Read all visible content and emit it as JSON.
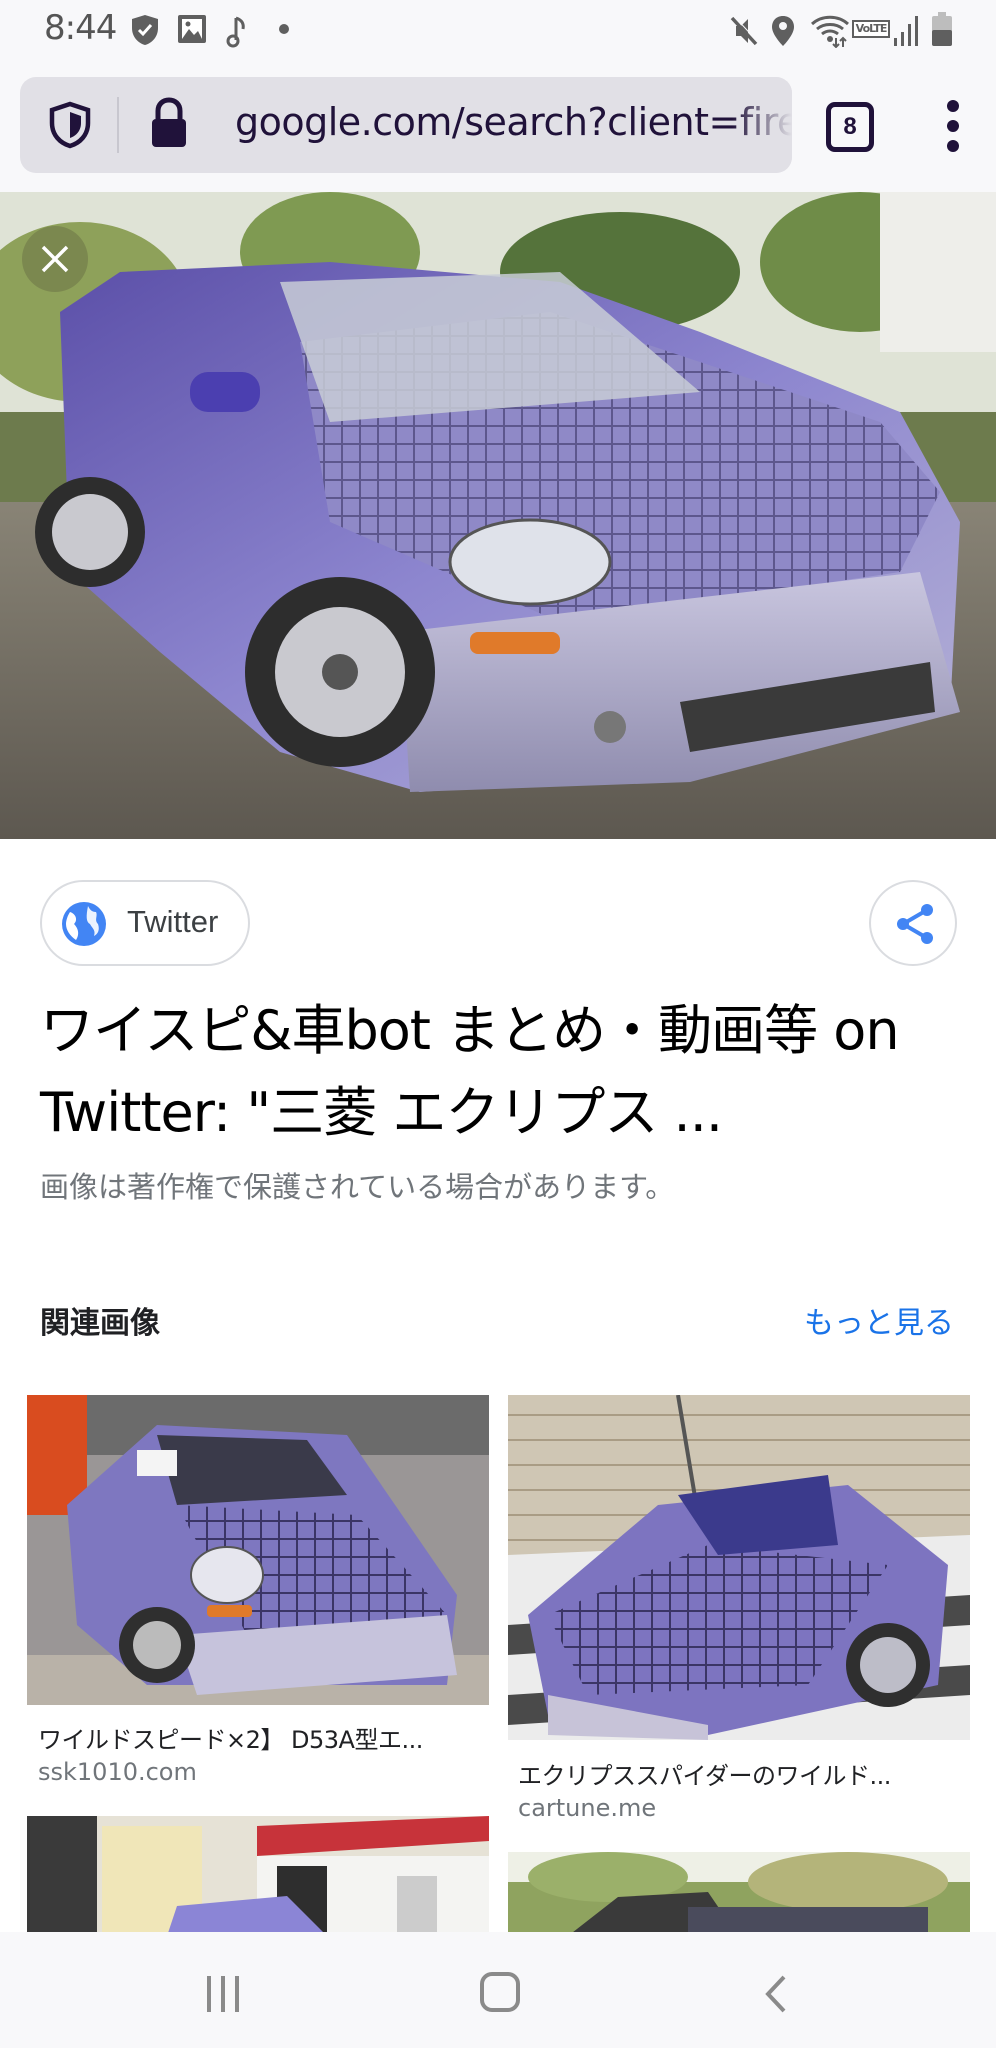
{
  "status_bar": {
    "time": "8:44",
    "left_icons": [
      "shield-check-icon",
      "gallery-icon",
      "music-note-icon",
      "notification-dot"
    ],
    "right_icons": [
      "mute-icon",
      "location-icon",
      "wifi-icon",
      "volte-icon",
      "signal-icon",
      "battery-icon"
    ],
    "volte_label": "VoLTE"
  },
  "browser": {
    "url": "google.com/search?client=firefox",
    "tab_count": "8"
  },
  "result": {
    "source_name": "Twitter",
    "title": "ワイスピ&車bot まとめ・動画等 on Twitter: \"三菱 エクリプス ...",
    "copyright_note": "画像は著作権で保護されている場合があります。"
  },
  "related": {
    "header": "関連画像",
    "see_more": "もっと見る",
    "items": [
      {
        "title": "ワイルドスピード×2】 D53A型エ...",
        "domain": "ssk1010.com"
      },
      {
        "title": "エクリプススパイダーのワイルド...",
        "domain": "cartune.me"
      },
      {
        "title": "",
        "domain": ""
      },
      {
        "title": "",
        "domain": ""
      }
    ]
  },
  "colors": {
    "accent_blue": "#1a73e8",
    "url_text": "#20123a",
    "car_purple": "#7a6fc4"
  }
}
